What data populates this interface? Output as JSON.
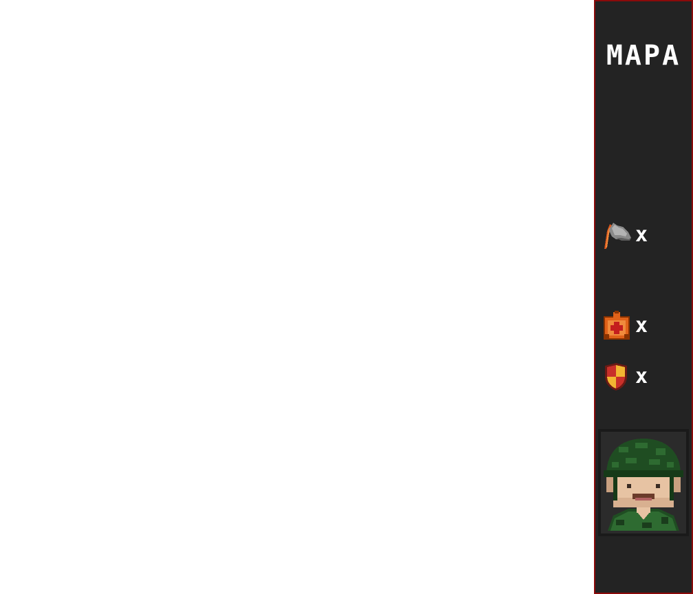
{
  "panel": {
    "title": "MAPA",
    "inventory": [
      {
        "icon": "grenade-launcher-icon",
        "multiplier": "x"
      },
      {
        "icon": "medkit-icon",
        "multiplier": "x"
      },
      {
        "icon": "shield-icon",
        "multiplier": "x"
      }
    ],
    "portrait": {
      "icon": "soldier-portrait-icon"
    }
  },
  "colors": {
    "panel_bg": "#232323",
    "panel_border": "#8b0a0a",
    "text": "#ffffff",
    "medkit": "#e0621a",
    "shield_red": "#c8302a",
    "shield_yellow": "#f2b632",
    "helmet": "#1f4d22",
    "skin": "#e7c3a3"
  }
}
